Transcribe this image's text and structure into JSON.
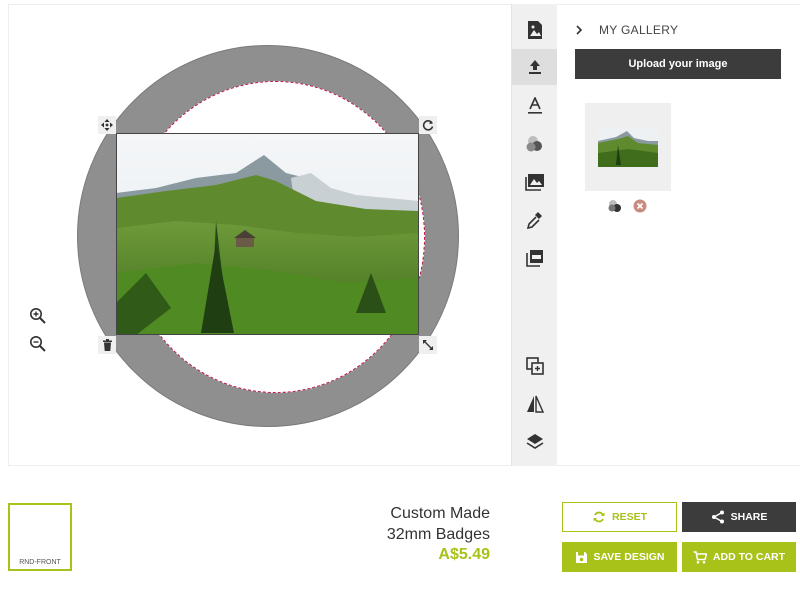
{
  "gallery": {
    "title": "MY GALLERY",
    "upload_label": "Upload your image"
  },
  "preview": {
    "label": "RND-FRONT"
  },
  "product": {
    "name_line1": "Custom Made",
    "name_line2": "32mm Badges",
    "price": "A$5.49"
  },
  "actions": {
    "reset_label": "RESET",
    "share_label": "SHARE",
    "save_label": "SAVE DESIGN",
    "cart_label": "ADD TO CART"
  },
  "toolbar": {
    "items": [
      {
        "icon": "image-file-icon"
      },
      {
        "icon": "upload-icon",
        "active": true
      },
      {
        "icon": "text-icon"
      },
      {
        "icon": "color-circles-icon"
      },
      {
        "icon": "picture-icon"
      },
      {
        "icon": "eyedropper-icon"
      },
      {
        "icon": "pdf-icon"
      },
      {
        "icon": "duplicate-icon"
      },
      {
        "icon": "flip-icon"
      },
      {
        "icon": "layers-icon"
      }
    ]
  },
  "colors": {
    "accent": "#a9c219",
    "dark": "#3c3c3c",
    "ring": "#8f8f8f",
    "bleed_line": "#c2185b"
  }
}
